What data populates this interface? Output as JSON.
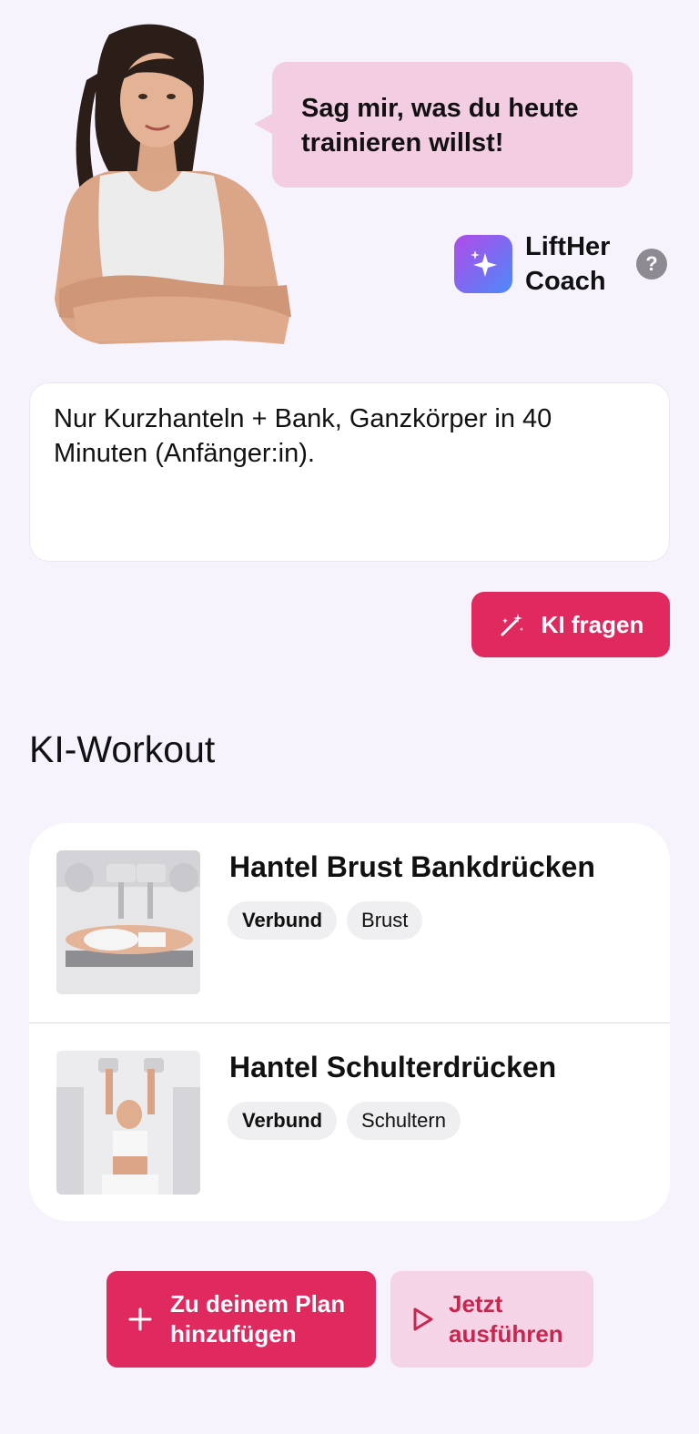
{
  "header": {
    "speech_bubble": "Sag mir, was du heute trainieren willst!",
    "brand_name": "LiftHer Coach",
    "help_label": "?"
  },
  "prompt": {
    "value": "Nur Kurzhanteln + Bank, Ganzkörper in 40 Minuten (Anfänger:in)."
  },
  "ask_button": {
    "label": "KI fragen",
    "icon": "magic-wand-icon"
  },
  "workout": {
    "title": "KI-Workout",
    "exercises": [
      {
        "name": "Hantel Brust Bankdrücken",
        "tags": [
          "Verbund",
          "Brust"
        ]
      },
      {
        "name": "Hantel Schulterdrücken",
        "tags": [
          "Verbund",
          "Schultern"
        ]
      }
    ]
  },
  "actions": {
    "add_to_plan": "Zu deinem Plan hinzufügen",
    "run_now": "Jetzt ausführen"
  },
  "colors": {
    "background": "#f7f3fd",
    "accent": "#e0295f",
    "bubble": "#f3cde2",
    "secondary_button": "#f4d4e6"
  }
}
